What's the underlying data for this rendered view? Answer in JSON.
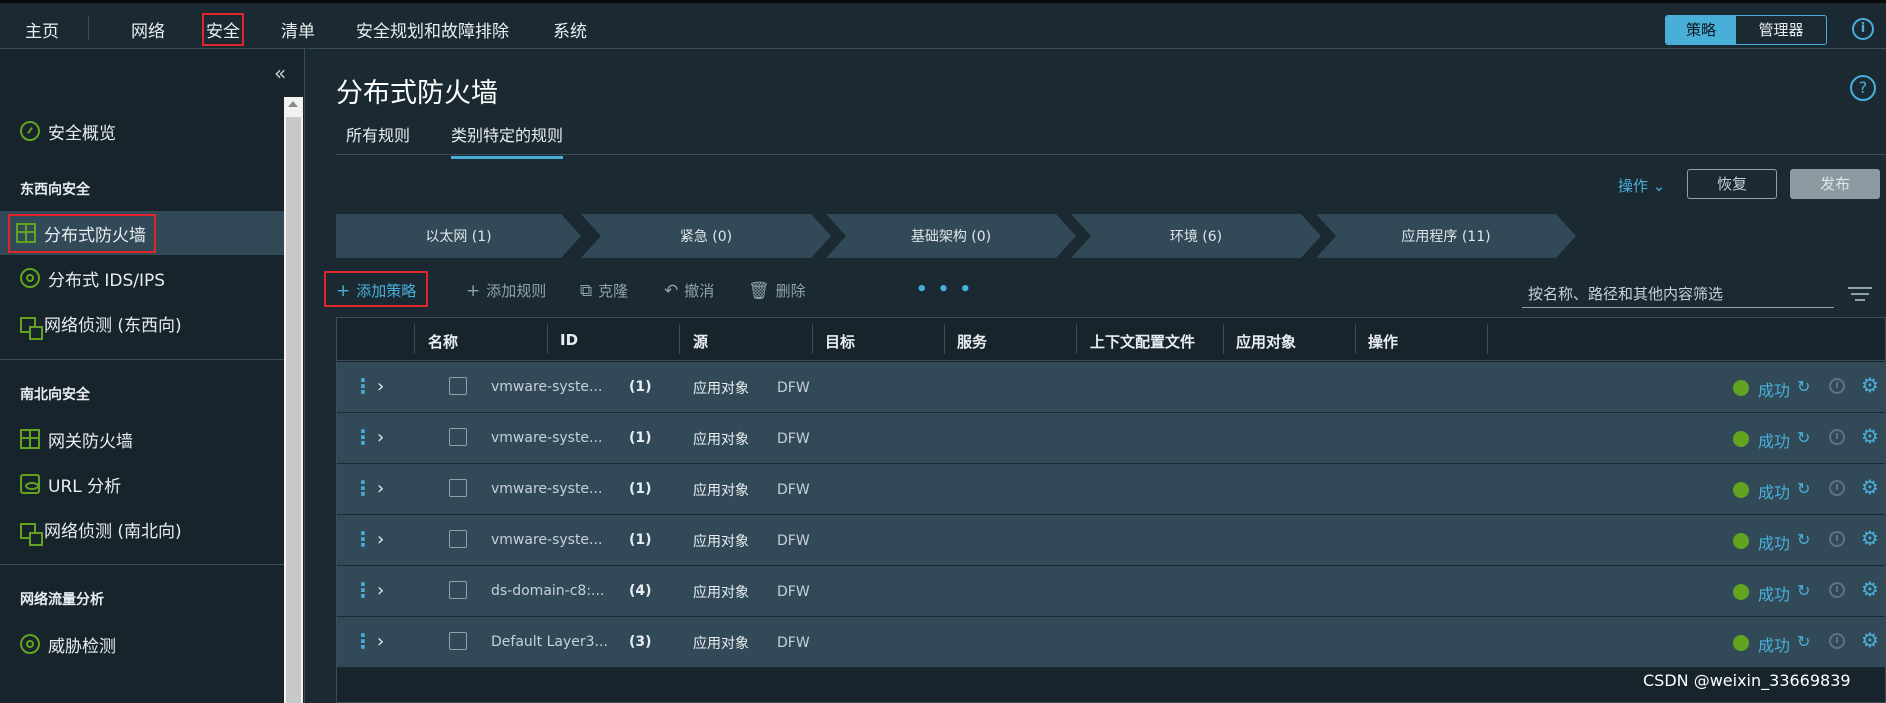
{
  "topnav": {
    "items": [
      "主页",
      "网络",
      "安全",
      "清单",
      "安全规划和故障排除",
      "系统"
    ],
    "toggle": {
      "active": "策略",
      "inactive": "管理器"
    },
    "info_icon": "i"
  },
  "sidebar": {
    "collapse_icon": "«",
    "overview": "安全概览",
    "ew_header": "东西向安全",
    "ew_items": [
      "分布式防火墙",
      "分布式 IDS/IPS",
      "网络侦测 (东西向)"
    ],
    "ns_header": "南北向安全",
    "ns_items": [
      "网关防火墙",
      "URL 分析",
      "网络侦测 (南北向)"
    ],
    "nta_header": "网络流量分析",
    "nta_items": [
      "威胁检测"
    ]
  },
  "main": {
    "title": "分布式防火墙",
    "help_icon": "?",
    "tabs": [
      "所有规则",
      "类别特定的规则"
    ],
    "actions_label": "操作 ⌄",
    "revert_label": "恢复",
    "publish_label": "发布",
    "categories": [
      "以太网 (1)",
      "紧急 (0)",
      "基础架构 (0)",
      "环境 (6)",
      "应用程序 (11)"
    ],
    "toolbar": {
      "add_policy": "添加策略",
      "add_rule": "添加规则",
      "clone": "克隆",
      "undo": "撤消",
      "delete": "删除",
      "more": "• • •"
    },
    "filter_placeholder": "按名称、路径和其他内容筛选",
    "columns": [
      "名称",
      "ID",
      "源",
      "目标",
      "服务",
      "上下文配置文件",
      "应用对象",
      "操作"
    ],
    "rows": [
      {
        "name": "vmware-syste...",
        "count": "(1)",
        "applied": "应用对象",
        "applied_value": "DFW",
        "status": "成功"
      },
      {
        "name": "vmware-syste...",
        "count": "(1)",
        "applied": "应用对象",
        "applied_value": "DFW",
        "status": "成功"
      },
      {
        "name": "vmware-syste...",
        "count": "(1)",
        "applied": "应用对象",
        "applied_value": "DFW",
        "status": "成功"
      },
      {
        "name": "vmware-syste...",
        "count": "(1)",
        "applied": "应用对象",
        "applied_value": "DFW",
        "status": "成功"
      },
      {
        "name": "ds-domain-c8:...",
        "count": "(4)",
        "applied": "应用对象",
        "applied_value": "DFW",
        "status": "成功"
      },
      {
        "name": "Default Layer3...",
        "count": "(3)",
        "applied": "应用对象",
        "applied_value": "DFW",
        "status": "成功"
      }
    ]
  },
  "watermark": "CSDN @weixin_33669839"
}
